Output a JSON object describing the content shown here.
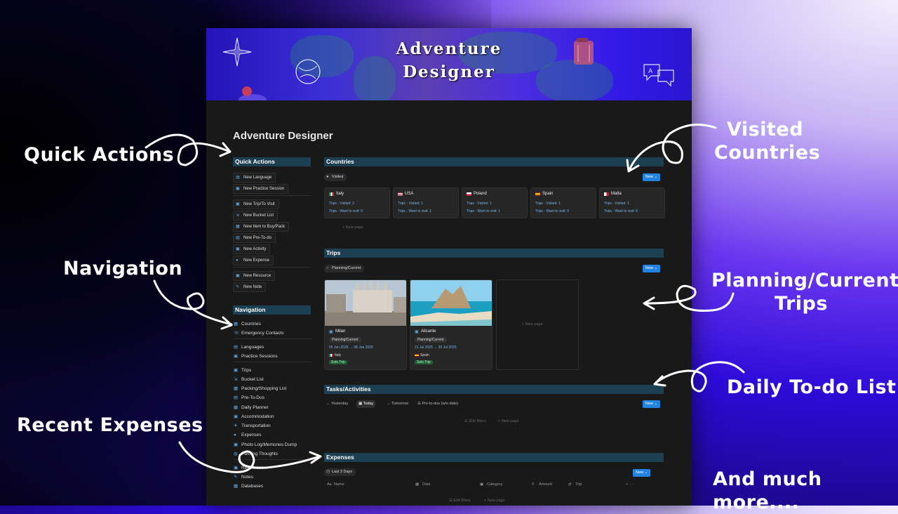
{
  "annotations": {
    "quick_actions": "Quick Actions",
    "visited_countries_1": "Visited",
    "visited_countries_2": "Countries",
    "navigation": "Navigation",
    "planning_trips_1": "Planning/Current",
    "planning_trips_2": "Trips",
    "daily_todo": "Daily To-do List",
    "recent_expenses": "Recent Expenses",
    "much_more": "And much more...."
  },
  "banner": {
    "title_line1": "Adventure",
    "title_line2": "Designer"
  },
  "page": {
    "title": "Adventure Designer"
  },
  "quick_actions": {
    "heading": "Quick Actions",
    "items": [
      {
        "label": "New Language",
        "icon": "language-icon"
      },
      {
        "label": "New Practice Session",
        "icon": "practice-icon"
      },
      {
        "label": "New Trip/To Visit",
        "icon": "trip-icon"
      },
      {
        "label": "New Bucket List",
        "icon": "bucket-icon"
      },
      {
        "label": "New Item to Buy/Pack",
        "icon": "bag-icon"
      },
      {
        "label": "New Pre-To-do",
        "icon": "checklist-icon"
      },
      {
        "label": "New Activity",
        "icon": "activity-icon"
      },
      {
        "label": "New Expense",
        "icon": "coin-icon"
      },
      {
        "label": "New Resource",
        "icon": "resource-icon"
      },
      {
        "label": "New Note",
        "icon": "note-icon"
      }
    ]
  },
  "navigation": {
    "heading": "Navigation",
    "items": [
      {
        "label": "Countries"
      },
      {
        "label": "Emergency Contacts"
      },
      {
        "label": "Languages"
      },
      {
        "label": "Practice Sessions"
      },
      {
        "label": "Trips"
      },
      {
        "label": "Bucket List"
      },
      {
        "label": "Packing/Shopping List"
      },
      {
        "label": "Pre-To-Dos"
      },
      {
        "label": "Daily Planner"
      },
      {
        "label": "Accommodation"
      },
      {
        "label": "Transportation"
      },
      {
        "label": "Expenses"
      },
      {
        "label": "Photo Log/Memories Dump"
      },
      {
        "label": "Passing Thoughts"
      },
      {
        "label": "Resources"
      },
      {
        "label": "Notes"
      },
      {
        "label": "Databases"
      }
    ]
  },
  "countries": {
    "heading": "Countries",
    "filter": "Visited",
    "new_label": "New",
    "new_page": "+ New page",
    "trips_visited_label": "Trips - Visited:",
    "trips_want_label": "Trips - Want to visit:",
    "cards": [
      {
        "name": "Italy",
        "visited": "2",
        "want": "0",
        "flag": "flag-it"
      },
      {
        "name": "USA",
        "visited": "1",
        "want": "1",
        "flag": "flag-us"
      },
      {
        "name": "Poland",
        "visited": "1",
        "want": "1",
        "flag": "flag-pl"
      },
      {
        "name": "Spain",
        "visited": "1",
        "want": "0",
        "flag": "flag-es"
      },
      {
        "name": "Malta",
        "visited": "1",
        "want": "0",
        "flag": "flag-mt"
      }
    ]
  },
  "trips": {
    "heading": "Trips",
    "filter": "Planning/Current",
    "new_label": "New",
    "new_page": "+ New page",
    "cards": [
      {
        "name": "Milan",
        "status": "Planning/Current",
        "dates": "05 Jun 2025 → 08 Jun 2025",
        "country": "Italy",
        "tag": "Solo Trip"
      },
      {
        "name": "Alicante",
        "status": "Planning/Current",
        "dates": "21 Jul 2025 → 30 Jul 2025",
        "country": "Spain",
        "tag": "Solo Trip"
      }
    ]
  },
  "tasks": {
    "heading": "Tasks/Activities",
    "tabs": [
      "Yesterday",
      "Today",
      "Tomorrow",
      "Pre-to-dos (w/o date)"
    ],
    "new_label": "New",
    "edit_filters": "Edit filters",
    "new_page": "+ New page"
  },
  "expenses": {
    "heading": "Expenses",
    "filter": "Last 3 Days",
    "new_label": "New",
    "columns": [
      "Name",
      "Date",
      "Category",
      "Amount",
      "Trip"
    ],
    "edit_filters": "Edit filters",
    "new_page": "+ New page"
  }
}
